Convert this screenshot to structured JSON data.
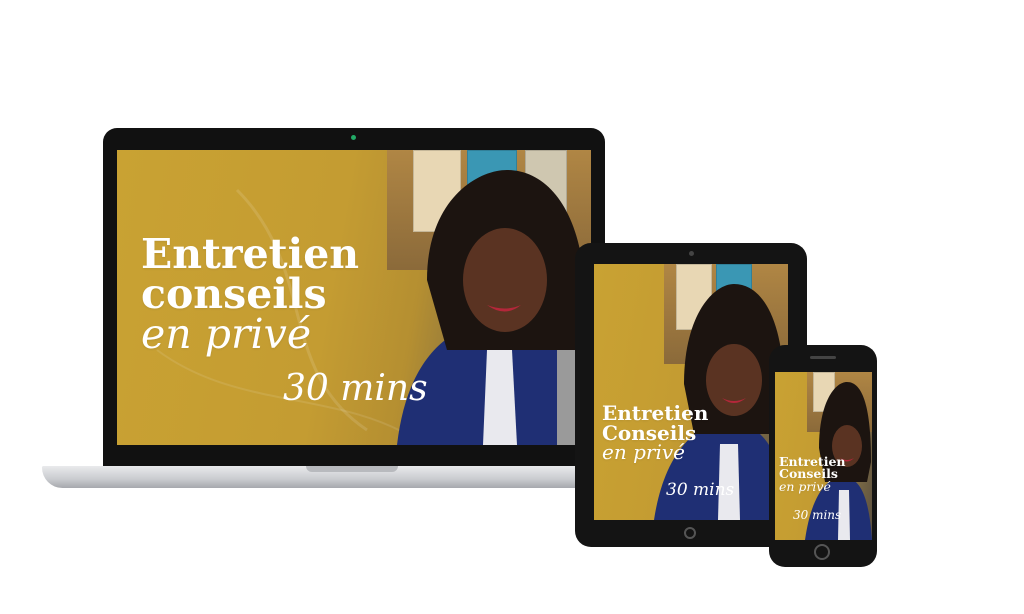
{
  "colors": {
    "gold": "#c49c32",
    "device_frame": "#111111",
    "text": "#ffffff"
  },
  "laptop": {
    "title_line1": "Entretien",
    "title_line2": "conseils",
    "title_line3": "en privé",
    "duration": "30 mins"
  },
  "tablet": {
    "title_line1": "Entretien",
    "title_line2": "Conseils",
    "title_line3": "en privé",
    "duration": "30 mins"
  },
  "phone": {
    "title_line1": "Entretien",
    "title_line2": "Conseils",
    "title_line3": "en privé",
    "duration": "30 mins"
  }
}
